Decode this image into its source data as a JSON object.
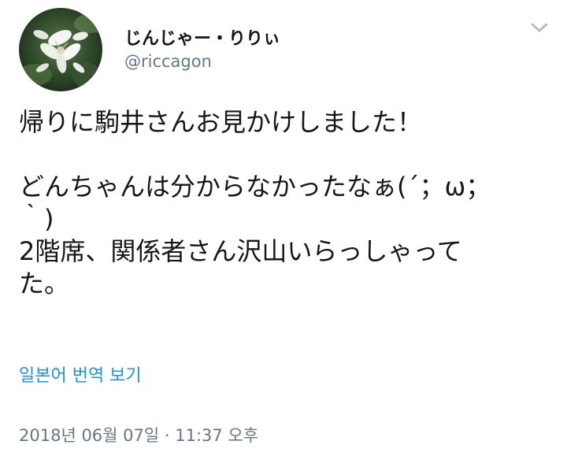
{
  "author": {
    "display_name": "じんじゃー・りりぃ",
    "handle": "@riccagon",
    "avatar_icon": "white-ginger-lily-flower-avatar"
  },
  "menu": {
    "icon": "chevron-down-icon"
  },
  "tweet": {
    "lines": [
      "帰りに駒井さんお見かけしました！",
      "",
      "どんちゃんは分からなかったなぁ(´；ω；",
      "｀)",
      "2階席、関係者さん沢山いらっしゃって",
      "た。"
    ]
  },
  "translate_label": "일본어 번역 보기",
  "timestamp": "2018년 06월 07일 · 11:37 오후",
  "colors": {
    "text": "#14171a",
    "secondary": "#657786",
    "link": "#1b95e0"
  }
}
